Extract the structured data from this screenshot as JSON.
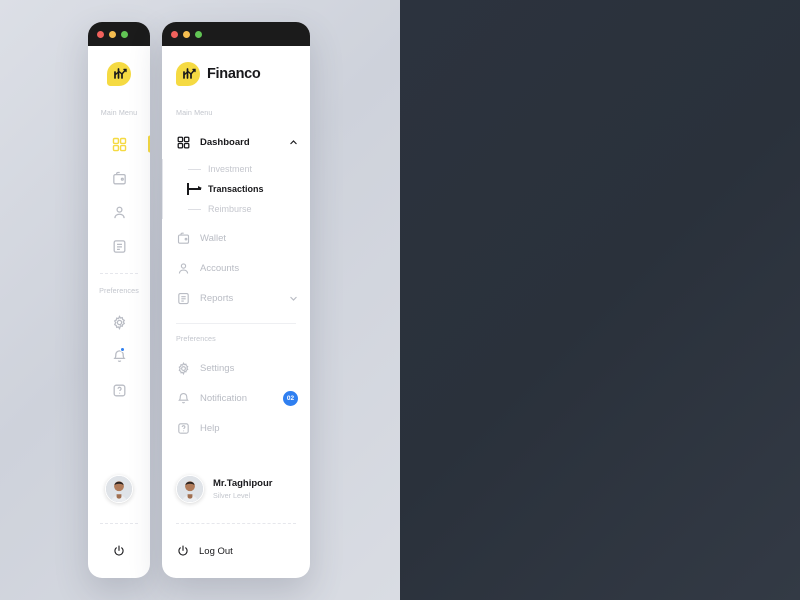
{
  "app": {
    "name": "Financo",
    "logo_icon": "financo-chart-logo",
    "accent_color": "#f5da42",
    "badge_color": "#2f7ff0",
    "light_bg": "#d4d7de",
    "dark_bg": "#2c333e",
    "light_panel": "#ffffff",
    "dark_panel": "#141414"
  },
  "titlebar": {
    "dots": [
      "close-dot-red",
      "minimize-dot-yellow",
      "maximize-dot-green"
    ],
    "colors": [
      "#f0615c",
      "#f5bd4f",
      "#61c454"
    ]
  },
  "sections": {
    "main_menu": "Main Menu",
    "preferences": "Preferences"
  },
  "menu": {
    "dashboard": {
      "label": "Dashboard",
      "icon": "grid-icon",
      "chevron": "chevron-up-icon",
      "expanded": true,
      "active": true
    },
    "submenu": [
      {
        "label": "Investment",
        "active": false
      },
      {
        "label": "Transactions",
        "active": true
      },
      {
        "label": "Reimburse",
        "active": false
      }
    ],
    "items": [
      {
        "label": "Wallet",
        "icon": "wallet-icon",
        "chevron": null
      },
      {
        "label": "Accounts",
        "icon": "user-icon",
        "chevron": null
      },
      {
        "label": "Reports",
        "icon": "report-icon",
        "chevron": "chevron-down-icon"
      }
    ]
  },
  "preferences": {
    "items": [
      {
        "label": "Settings",
        "icon": "gear-icon",
        "badge": null
      },
      {
        "label": "Notification",
        "icon": "bell-icon",
        "badge": "02"
      },
      {
        "label": "Help",
        "icon": "help-icon",
        "badge": null
      }
    ]
  },
  "profile": {
    "name": "Mr.Taghipour",
    "level": "Silver Level",
    "avatar_icon": "user-avatar"
  },
  "logout": {
    "label": "Log Out",
    "icon": "power-icon"
  }
}
